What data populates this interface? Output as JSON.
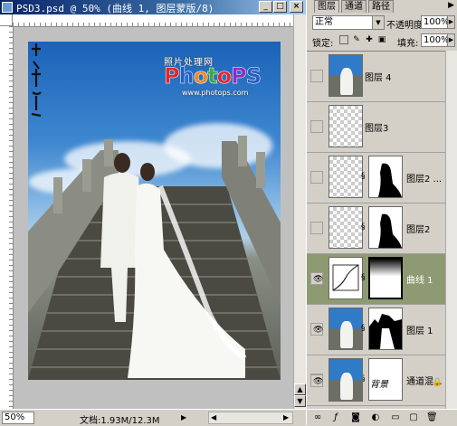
{
  "document": {
    "title": "PSD3.psd @ 50% (曲线 1, 图层蒙版/8)",
    "zoom": "50%",
    "doc_info": "文档:1.93M/12.3M",
    "logo": {
      "small_text": "照片处理网",
      "main_text": [
        "P",
        "h",
        "o",
        "t",
        "o",
        "P",
        "S"
      ],
      "main_colors": [
        "#e8232b",
        "#2a5bc4",
        "#f08a1c",
        "#3aa83a",
        "#e8232b",
        "#8a2fbf",
        "#2a5bc4"
      ],
      "url": "www.photops.com"
    }
  },
  "panel": {
    "tabs": [
      "图层",
      "通道",
      "路径"
    ],
    "active_tab": 0,
    "blend_mode": "正常",
    "opacity_label": "不透明度:",
    "opacity_value": "100%",
    "lock_label": "锁定:",
    "fill_label": "填充:",
    "fill_value": "100%",
    "layers": [
      {
        "name": "图层 4",
        "visible": false,
        "thumb": "photo",
        "mask": null,
        "selected": false
      },
      {
        "name": "图层3",
        "visible": false,
        "thumb": "transparent",
        "mask": null,
        "selected": false
      },
      {
        "name": "图层2 ...",
        "visible": false,
        "thumb": "transparent",
        "mask": "silhouette",
        "selected": false
      },
      {
        "name": "图层2",
        "visible": false,
        "thumb": "transparent",
        "mask": "silhouette",
        "selected": false
      },
      {
        "name": "曲线 1",
        "visible": true,
        "thumb": "curves",
        "mask": "gradient",
        "selected": true
      },
      {
        "name": "图层 1",
        "visible": true,
        "thumb": "photo",
        "mask": "stairs",
        "selected": false
      },
      {
        "name": "通道混...",
        "visible": true,
        "thumb": "mixer",
        "mask": "white",
        "selected": false
      },
      {
        "name": "背景",
        "visible": true,
        "thumb": "photo",
        "mask": null,
        "selected": false,
        "locked": true
      }
    ]
  },
  "colors": {
    "selected_row": "#8e9a72",
    "title_bar": "#0a246a"
  }
}
